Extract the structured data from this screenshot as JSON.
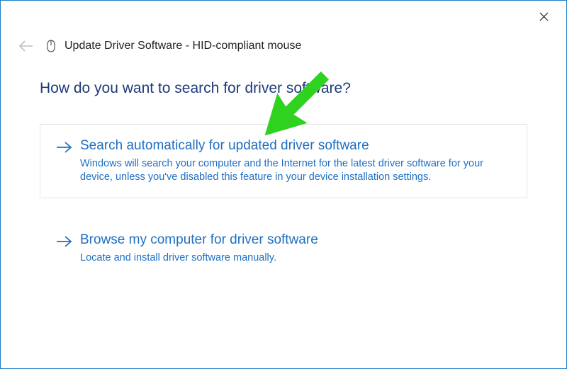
{
  "window": {
    "title": "Update Driver Software - HID-compliant mouse"
  },
  "heading": "How do you want to search for driver software?",
  "options": [
    {
      "title": "Search automatically for updated driver software",
      "description": "Windows will search your computer and the Internet for the latest driver software for your device, unless you've disabled this feature in your device installation settings."
    },
    {
      "title": "Browse my computer for driver software",
      "description": "Locate and install driver software manually."
    }
  ]
}
